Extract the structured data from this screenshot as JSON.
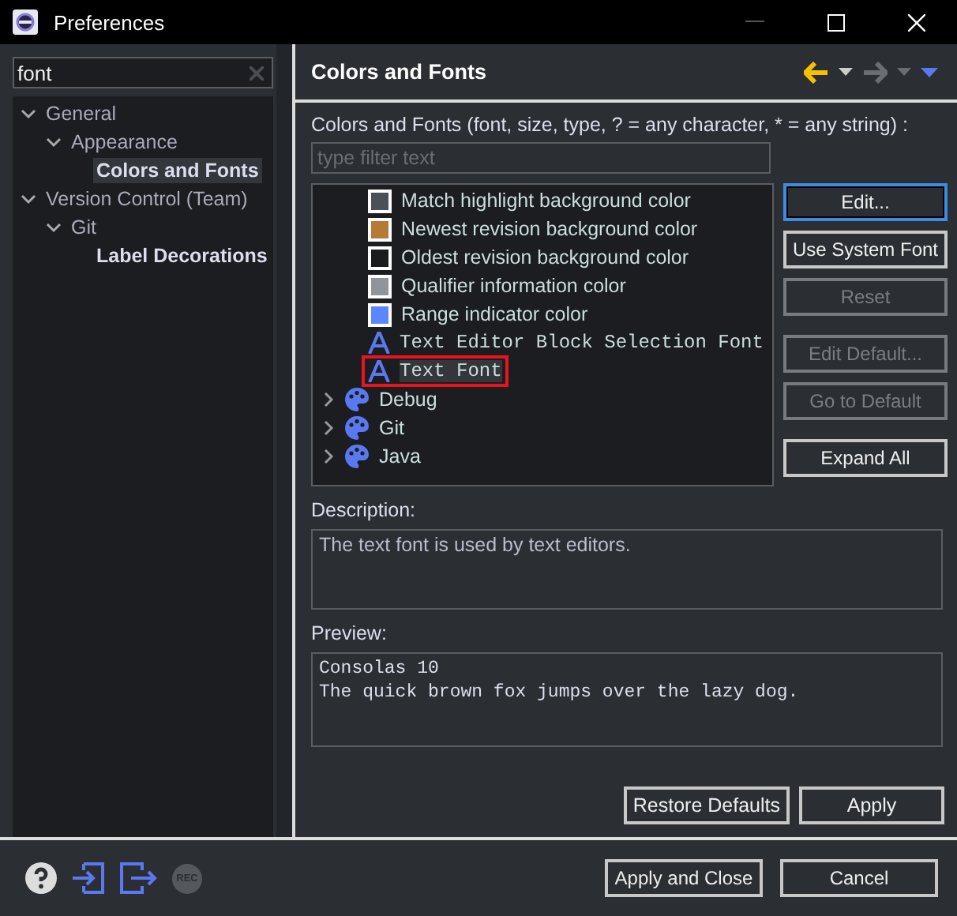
{
  "window": {
    "title": "Preferences"
  },
  "search": {
    "value": "font"
  },
  "nav_tree": [
    {
      "label": "General",
      "expanded": true,
      "selected": false,
      "children": [
        {
          "label": "Appearance",
          "expanded": true,
          "selected": false,
          "children": [
            {
              "label": "Colors and Fonts",
              "selected": true,
              "match": true
            }
          ]
        }
      ]
    },
    {
      "label": "Version Control (Team)",
      "expanded": true,
      "selected": false,
      "children": [
        {
          "label": "Git",
          "expanded": true,
          "selected": false,
          "children": [
            {
              "label": "Label Decorations",
              "selected": false,
              "match": true
            }
          ]
        }
      ]
    }
  ],
  "page": {
    "title": "Colors and Fonts",
    "intro": "Colors and Fonts (font, size, type, ? = any character, * = any string) :",
    "filter": {
      "placeholder": "type filter text"
    }
  },
  "items": [
    {
      "kind": "color",
      "label": "Match highlight background color",
      "color": "#4a5056",
      "selected": false,
      "highlighted": false
    },
    {
      "kind": "color",
      "label": "Newest revision background color",
      "color": "#b57a34",
      "selected": false,
      "highlighted": false
    },
    {
      "kind": "color",
      "label": "Oldest revision background color",
      "color": "#1a1c1e",
      "selected": false,
      "highlighted": false
    },
    {
      "kind": "color",
      "label": "Qualifier information color",
      "color": "#8f959b",
      "selected": false,
      "highlighted": false
    },
    {
      "kind": "color",
      "label": "Range indicator color",
      "color": "#5a86ff",
      "selected": false,
      "highlighted": false
    },
    {
      "kind": "font",
      "label": "Text Editor Block Selection Font",
      "selected": false,
      "highlighted": false
    },
    {
      "kind": "font",
      "label": "Text Font",
      "selected": true,
      "highlighted": true
    },
    {
      "kind": "category",
      "label": "Debug",
      "expanded": false,
      "selected": false,
      "highlighted": false
    },
    {
      "kind": "category",
      "label": "Git",
      "expanded": false,
      "selected": false,
      "highlighted": false
    },
    {
      "kind": "category",
      "label": "Java",
      "expanded": false,
      "selected": false,
      "highlighted": false
    }
  ],
  "side_button_groups": [
    [
      {
        "label": "Edit...",
        "disabled": false,
        "focused": true
      },
      {
        "label": "Use System Font",
        "disabled": false,
        "focused": false
      },
      {
        "label": "Reset",
        "disabled": true,
        "focused": false
      }
    ],
    [
      {
        "label": "Edit Default...",
        "disabled": true,
        "focused": false
      },
      {
        "label": "Go to Default",
        "disabled": true,
        "focused": false
      }
    ],
    [
      {
        "label": "Expand All",
        "disabled": false,
        "focused": false
      }
    ]
  ],
  "description": {
    "label": "Description:",
    "text": "The text font is used by text editors."
  },
  "preview": {
    "label": "Preview:",
    "lines": [
      "Consolas 10",
      "The quick brown fox jumps over the lazy dog."
    ]
  },
  "page_buttons": [
    "Restore Defaults",
    "Apply"
  ],
  "footer": {
    "rec_label": "REC",
    "buttons": [
      "Apply and Close",
      "Cancel"
    ]
  }
}
